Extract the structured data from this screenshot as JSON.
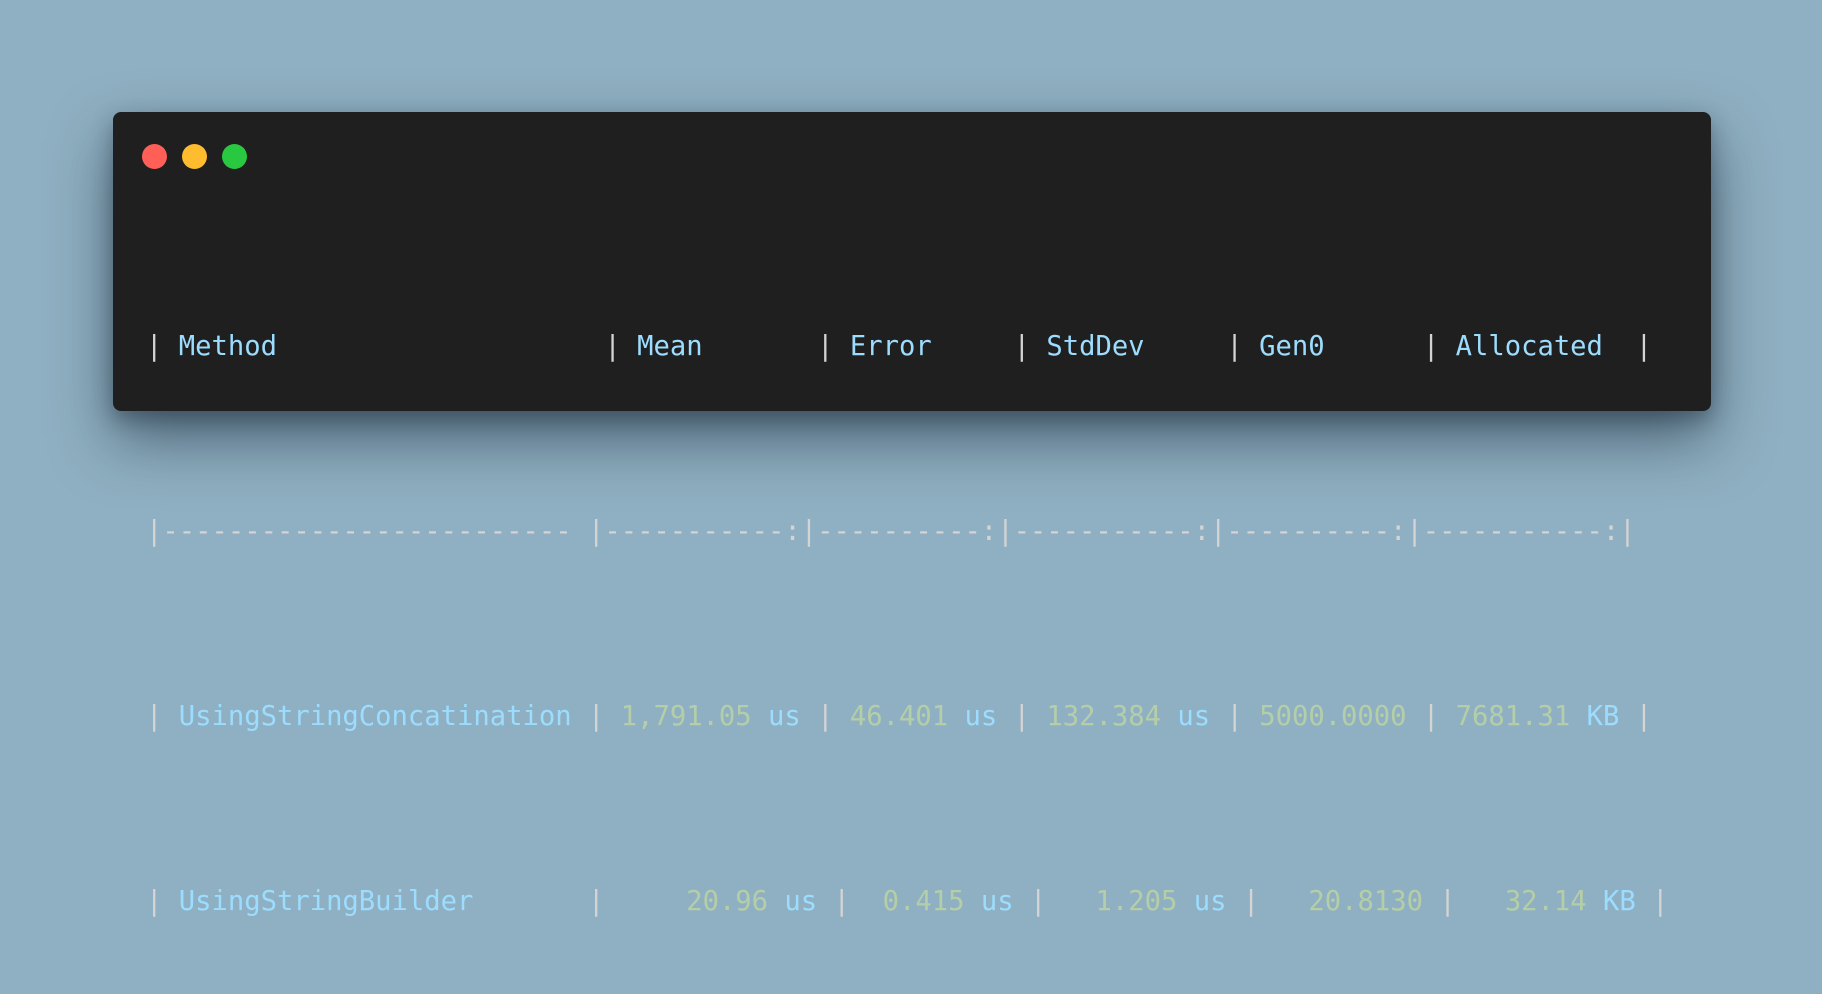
{
  "window": {
    "controls": [
      "close",
      "minimize",
      "maximize"
    ]
  },
  "table": {
    "headers": {
      "method": "Method",
      "mean": "Mean",
      "error": "Error",
      "stddev": "StdDev",
      "gen0": "Gen0",
      "allocated": "Allocated"
    },
    "separator": {
      "method": "------------------------- ",
      "mean": "-----------:",
      "error": "----------:",
      "stddev": "-----------:",
      "gen0": "----------:",
      "allocated": "-----------:"
    },
    "rows": [
      {
        "method": "UsingStringConcatination",
        "mean_value": "1,791.05",
        "mean_unit": "us",
        "error_value": "46.401",
        "error_unit": "us",
        "stddev_value": "132.384",
        "stddev_unit": "us",
        "gen0": "5000.0000",
        "allocated_value": "7681.31",
        "allocated_unit": "KB"
      },
      {
        "method": "UsingStringBuilder",
        "mean_value": "20.96",
        "mean_unit": "us",
        "error_value": "0.415",
        "error_unit": "us",
        "stddev_value": "1.205",
        "stddev_unit": "us",
        "gen0": "20.8130",
        "allocated_value": "32.14",
        "allocated_unit": "KB"
      }
    ]
  }
}
